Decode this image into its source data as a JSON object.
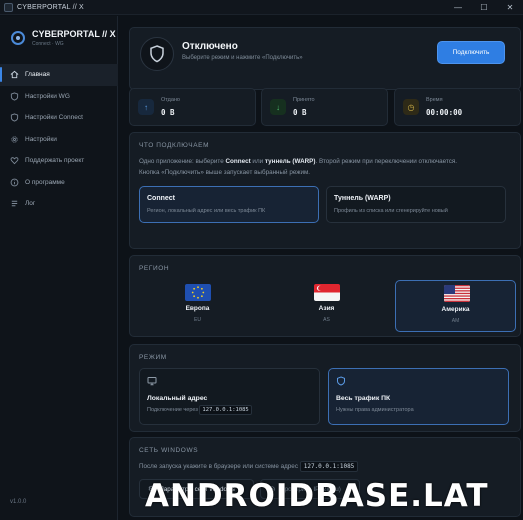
{
  "window": {
    "title": "CYBERPORTAL // X",
    "controls": [
      "—",
      "☐",
      "✕"
    ]
  },
  "sidebar": {
    "brand": {
      "name": "CYBERPORTAL // X",
      "subtitle": "Connect · WG"
    },
    "items": [
      {
        "label": "Главная",
        "icon": "home-icon",
        "active": true
      },
      {
        "label": "Настройки WG",
        "icon": "shield-icon",
        "active": false
      },
      {
        "label": "Настройки Connect",
        "icon": "shield-icon",
        "active": false
      },
      {
        "label": "Настройки",
        "icon": "gear-icon",
        "active": false
      },
      {
        "label": "Поддержать проект",
        "icon": "heart-icon",
        "active": false
      },
      {
        "label": "О программе",
        "icon": "info-icon",
        "active": false
      },
      {
        "label": "Лог",
        "icon": "log-icon",
        "active": false
      }
    ],
    "version": "v1.0.0"
  },
  "status": {
    "title": "Отключено",
    "subtitle": "Выберите режим и нажмите «Подключить»",
    "connect_button": "Подключить"
  },
  "stats": [
    {
      "label": "Отдано",
      "value": "0 B",
      "icon": "arrow-up-icon"
    },
    {
      "label": "Принято",
      "value": "0 B",
      "icon": "arrow-down-icon"
    },
    {
      "label": "Время",
      "value": "00:00:00",
      "icon": "clock-icon"
    }
  ],
  "connect_what": {
    "heading": "ЧТО ПОДКЛЮЧАЕМ",
    "desc_1": "Одно приложение: выберите ",
    "desc_b1": "Connect",
    "desc_2": " или ",
    "desc_b2": "туннель (WARP)",
    "desc_3": ". Второй режим при переключении отключается.",
    "desc_4": "Кнопка «Подключить» выше запускает выбранный режим.",
    "options": [
      {
        "title": "Connect",
        "subtitle": "Регион, локальный адрес или весь трафик ПК",
        "active": true
      },
      {
        "title": "Туннель (WARP)",
        "subtitle": "Профиль из списка или сгенерируйте новый",
        "active": false
      }
    ]
  },
  "region": {
    "heading": "РЕГИОН",
    "items": [
      {
        "name": "Европа",
        "sub": "EU",
        "flag": "eu-flag-icon",
        "active": false
      },
      {
        "name": "Азия",
        "sub": "AS",
        "flag": "singapore-flag-icon",
        "active": false
      },
      {
        "name": "Америка",
        "sub": "AM",
        "flag": "usa-flag-icon",
        "active": true
      }
    ]
  },
  "mode": {
    "heading": "РЕЖИМ",
    "local": {
      "title": "Локальный адрес",
      "sub_prefix": "Подключение через",
      "address": "127.0.0.1:1085",
      "icon": "monitor-icon"
    },
    "full": {
      "title": "Весь трафик ПК",
      "sub": "Нужны права администратора",
      "icon": "shield-icon"
    }
  },
  "windows_net": {
    "heading": "СЕТЬ WINDOWS",
    "desc": "После запуска укажите в браузере или системе адрес",
    "address": "127.0.0.1:1085",
    "btn_settings": "Параметры сети Windows",
    "btn_check": "Проверить IP (2ip.ru)"
  },
  "watermark": "ANDROIDBASE.LAT",
  "colors": {
    "accent": "#2f7ee3",
    "background": "#0d1218",
    "card": "#151c24",
    "selected_border": "#3c6fb4"
  }
}
